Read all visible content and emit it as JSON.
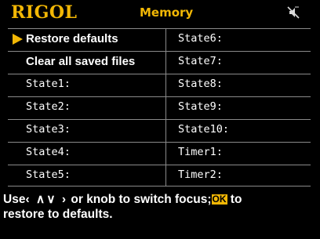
{
  "header": {
    "logo": "RIGOL",
    "title": "Memory",
    "mute_icon": "speaker-muted-icon"
  },
  "left_items": [
    {
      "label": "Restore defaults",
      "selected": true
    },
    {
      "label": "Clear all saved files"
    },
    {
      "label": "State1:"
    },
    {
      "label": "State2:"
    },
    {
      "label": "State3:"
    },
    {
      "label": "State4:"
    },
    {
      "label": "State5:"
    }
  ],
  "right_items": [
    {
      "label": "State6:"
    },
    {
      "label": "State7:"
    },
    {
      "label": "State8:"
    },
    {
      "label": "State9:"
    },
    {
      "label": "State10:"
    },
    {
      "label": "Timer1:"
    },
    {
      "label": "Timer2:"
    }
  ],
  "help": {
    "use": "Use",
    "keys": "‹ ∧∨ ›",
    "middle": " or knob to switch focus;",
    "ok_key": "OK",
    "end": " to",
    "line2": "restore to defaults."
  },
  "colors": {
    "accent": "#f2b705",
    "background": "#000000",
    "grid": "#8a8a8a",
    "text": "#ffffff"
  }
}
